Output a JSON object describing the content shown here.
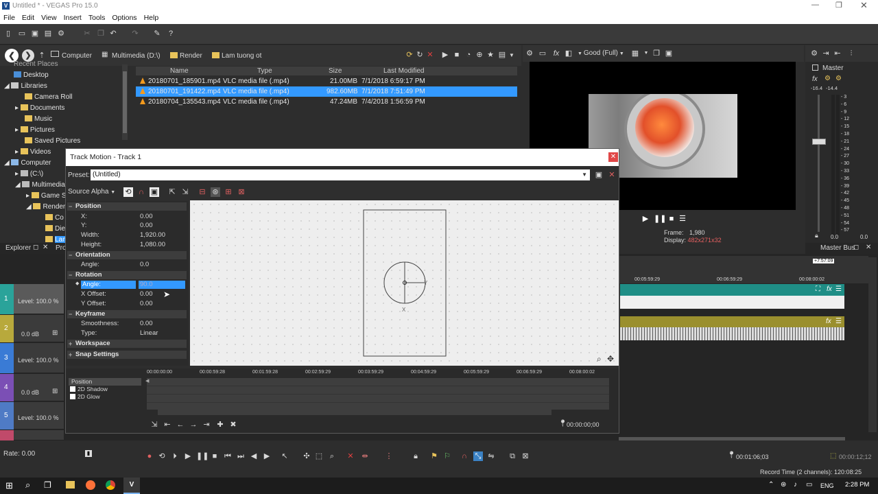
{
  "window": {
    "title": "Untitled * - VEGAS Pro 15.0"
  },
  "menu": [
    "File",
    "Edit",
    "View",
    "Insert",
    "Tools",
    "Options",
    "Help"
  ],
  "explorer": {
    "breadcrumbs": [
      "Computer",
      "Multimedia (D:\\)",
      "Render",
      "Lam tuong ot"
    ],
    "tree": [
      "Recent Places",
      "Desktop",
      "Libraries",
      "Camera Roll",
      "Documents",
      "Music",
      "Pictures",
      "Saved Pictures",
      "Videos",
      "Computer",
      "(C:\\)",
      "Multimedia",
      "Game S",
      "Render",
      "Co",
      "Die",
      "Lam"
    ],
    "columns": [
      "Name",
      "Type",
      "Size",
      "Last Modified"
    ],
    "files": [
      {
        "name": "20180701_185901.mp4",
        "type": "VLC media file (.mp4)",
        "size": "21.00MB",
        "modified": "7/1/2018 6:59:17 PM"
      },
      {
        "name": "20180701_191422.mp4",
        "type": "VLC media file (.mp4)",
        "size": "982.60MB",
        "modified": "7/1/2018 7:51:49 PM"
      },
      {
        "name": "20180704_135543.mp4",
        "type": "VLC media file (.mp4)",
        "size": "47.24MB",
        "modified": "7/4/2018 1:56:59 PM"
      }
    ],
    "tab_explorer": "Explorer",
    "tab_pro": "Pro"
  },
  "preview": {
    "quality": "Good (Full)",
    "frame_label": "Frame:",
    "frame_value": "1,980",
    "display_label": "Display:",
    "display_value": "482x271x32"
  },
  "master": {
    "label": "Master",
    "left_db": "-16.4",
    "right_db": "-14.4",
    "bus_label": "Master Bus",
    "scale": [
      "3",
      "6",
      "9",
      "12",
      "15",
      "18",
      "21",
      "24",
      "27",
      "30",
      "33",
      "36",
      "39",
      "42",
      "45",
      "48",
      "51",
      "54",
      "57"
    ],
    "bottom_left": "0.0",
    "bottom_right": "0.0"
  },
  "dialog": {
    "title": "Track Motion - Track 1",
    "preset_label": "Preset:",
    "preset_value": "(Untitled)",
    "source_label": "Source Alpha",
    "sections": {
      "position": "Position",
      "orientation": "Orientation",
      "rotation": "Rotation",
      "keyframe": "Keyframe",
      "workspace": "Workspace",
      "snap": "Snap Settings"
    },
    "fields": {
      "x_label": "X:",
      "x_value": "0.00",
      "y_label": "Y:",
      "y_value": "0.00",
      "w_label": "Width:",
      "w_value": "1,920.00",
      "h_label": "Height:",
      "h_value": "1,080.00",
      "orient_label": "Angle:",
      "orient_value": "0.0",
      "rot_label": "Angle:",
      "rot_value": "90.0",
      "xoff_label": "X Offset:",
      "xoff_value": "0.00",
      "yoff_label": "Y Offset:",
      "yoff_value": "0.00",
      "smooth_label": "Smoothness:",
      "smooth_value": "0.00",
      "type_label": "Type:",
      "type_value": "Linear"
    },
    "timeline": {
      "ticks": [
        "00:00:00:00",
        "00:00:59:28",
        "00:01:59:28",
        "00:02:59:29",
        "00:03:59:29",
        "00:04:59:29",
        "00:05:59:29",
        "00:06:59:29",
        "00:08:00:02"
      ],
      "rows": [
        "Position",
        "2D Shadow",
        "2D Glow"
      ],
      "time": "00:00:00;00"
    }
  },
  "tracks": [
    {
      "num": "1",
      "level": "Level: 100.0 %"
    },
    {
      "num": "2",
      "level": "0.0 dB"
    },
    {
      "num": "3",
      "level": "Level: 100.0 %"
    },
    {
      "num": "4",
      "level": "0.0 dB"
    },
    {
      "num": "5",
      "level": "Level: 100.0 %"
    }
  ],
  "main_timeline": {
    "ticks": [
      "00:05:59:29",
      "00:06:59:29",
      "00:08:00:02"
    ],
    "end_marker": "+7:57:09"
  },
  "transport": {
    "rate": "Rate: 0.00",
    "cursor": "00:01:06;03",
    "selection": "00:00:12;12",
    "record_time": "Record Time (2 channels): 120:08:25"
  },
  "taskbar": {
    "lang": "ENG",
    "time": "2:28 PM"
  }
}
